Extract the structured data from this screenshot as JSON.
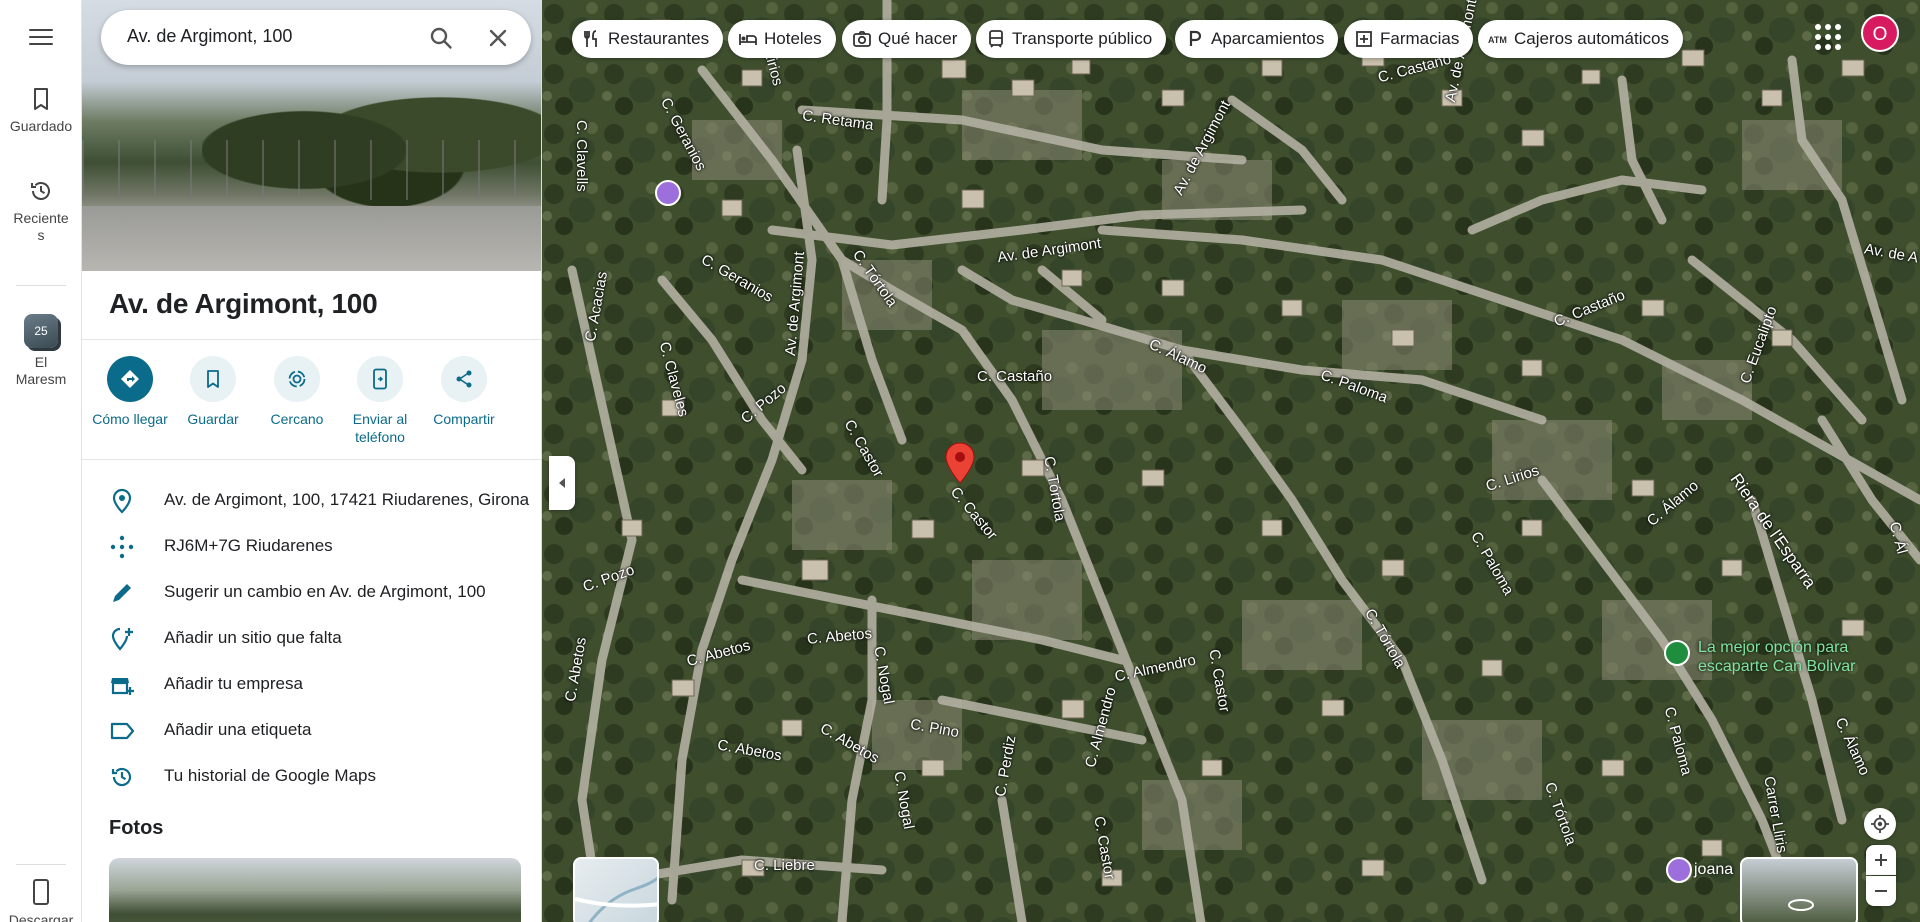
{
  "search": {
    "value": "Av. de Argimont, 100"
  },
  "rail": {
    "saved_label": "Guardado",
    "recent_label_1": "Reciente",
    "recent_label_2": "s",
    "recent_place_number": "25",
    "recent_place_label_1": "El",
    "recent_place_label_2": "Maresm",
    "download_label": "Descargar"
  },
  "place": {
    "title": "Av. de Argimont, 100",
    "actions": [
      {
        "label": "Cómo llegar"
      },
      {
        "label": "Guardar"
      },
      {
        "label": "Cercano"
      },
      {
        "label_1": "Enviar al",
        "label_2": "teléfono"
      },
      {
        "label": "Compartir"
      }
    ],
    "info": [
      {
        "icon": "location-pin-icon",
        "text": "Av. de Argimont, 100, 17421 Riudarenes, Girona"
      },
      {
        "icon": "plus-code-icon",
        "text": "RJ6M+7G Riudarenes"
      },
      {
        "icon": "pencil-icon",
        "text": "Sugerir un cambio en Av. de Argimont, 100"
      },
      {
        "icon": "add-place-icon",
        "text": "Añadir un sitio que falta"
      },
      {
        "icon": "add-business-icon",
        "text": "Añadir tu empresa"
      },
      {
        "icon": "label-icon",
        "text": "Añadir una etiqueta"
      },
      {
        "icon": "history-icon",
        "text": "Tu historial de Google Maps"
      }
    ],
    "photos_heading": "Fotos"
  },
  "chips": [
    {
      "icon": "restaurant-icon",
      "label": "Restaurantes"
    },
    {
      "icon": "hotel-icon",
      "label": "Hoteles"
    },
    {
      "icon": "camera-icon",
      "label": "Qué hacer"
    },
    {
      "icon": "transit-icon",
      "label": "Transporte público"
    },
    {
      "icon": "parking-icon",
      "label": "Aparcamientos"
    },
    {
      "icon": "pharmacy-icon",
      "label": "Farmacias"
    },
    {
      "icon": "atm-icon",
      "label": "Cajeros automáticos"
    }
  ],
  "account": {
    "initial": "O",
    "color": "#d81b60"
  },
  "map": {
    "streets": [
      "C. Clavells",
      "C. Geranios",
      "C. Retama",
      "C. Lirios",
      "Av. de Argimont",
      "Av. de Argimont",
      "Av. de Argimont",
      "Av. de A",
      "C. Castaño",
      "C. Castaño",
      "C. Geranios",
      "Av. de Argimont",
      "C. Tórtola",
      "C. Acacias",
      "C. Claveles",
      "C. Pozo",
      "C. Castaño",
      "C. Álamo",
      "C. Eucalipto",
      "C. Paloma",
      "C. Lirios",
      "Riera de l'Esparra",
      "C. Castor",
      "C. Tórtola",
      "C. Castor",
      "C. Álamo",
      "C. Paloma",
      "C. Abetos",
      "C. Abetos",
      "C. Pozo",
      "C. Nogal",
      "C. Almendro",
      "C. Castor",
      "C. Tórtola",
      "C. Pino",
      "C. Abetos",
      "C. Abetos",
      "C. Abetos",
      "C. Nogal",
      "C. Almendro",
      "C. Perdiz",
      "C. Liebre",
      "C. Castor",
      "C. Tórtola",
      "C. Paloma",
      "Carrer Lliris",
      "C. Álamo",
      "C. Ál"
    ],
    "poi_green_text_1": "La mejor opción para",
    "poi_green_text_2": "escaparte Can Bolivar",
    "poi_joana": "joana"
  },
  "colors": {
    "accent": "#0b6b8a",
    "pin": "#ea4335"
  }
}
